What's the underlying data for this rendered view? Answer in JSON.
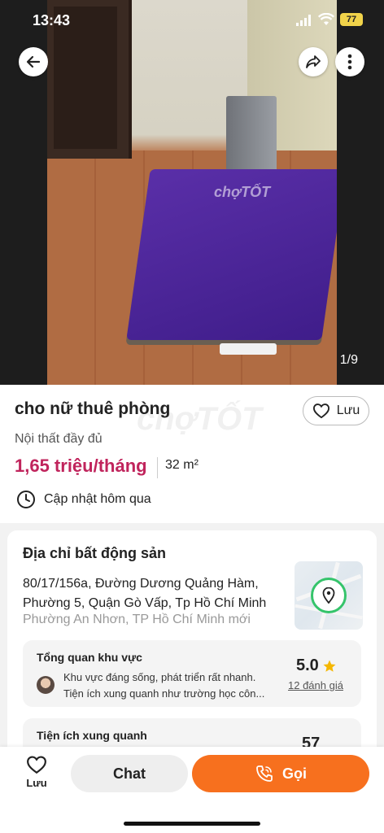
{
  "status_bar": {
    "time": "13:43",
    "battery": "77"
  },
  "photo": {
    "watermark": "chợTỐT",
    "counter": "1/9"
  },
  "listing": {
    "title": "cho nữ thuê phòng",
    "save_label": "Lưu",
    "subtitle": "Nội thất đầy đủ",
    "price": "1,65 triệu/tháng",
    "area": "32 m²",
    "updated": "Cập nhật hôm qua",
    "watermark": "chợTỐT"
  },
  "address_card": {
    "title": "Địa chỉ bất động sản",
    "address_line1": "80/17/156a, Đường Dương Quảng Hàm,",
    "address_line2": "Phường 5, Quận Gò Vấp, Tp Hồ Chí Minh",
    "address_new": "Phường An Nhơn, TP Hồ Chí Minh mới"
  },
  "area_overview": {
    "title": "Tổng quan khu vực",
    "review_line1": "Khu vực đáng sống, phát triển rất nhanh.",
    "review_line2": "Tiện ích xung quanh như trường học côn...",
    "rating": "5.0",
    "rating_count": "12 đánh giá"
  },
  "nearby": {
    "title": "Tiện ích xung quanh",
    "value": "57"
  },
  "bottom_bar": {
    "save_label": "Lưu",
    "chat_label": "Chat",
    "call_label": "Gọi"
  },
  "colors": {
    "price": "#c0245c",
    "call_button": "#f7701e",
    "rating_star": "#f5b700"
  }
}
